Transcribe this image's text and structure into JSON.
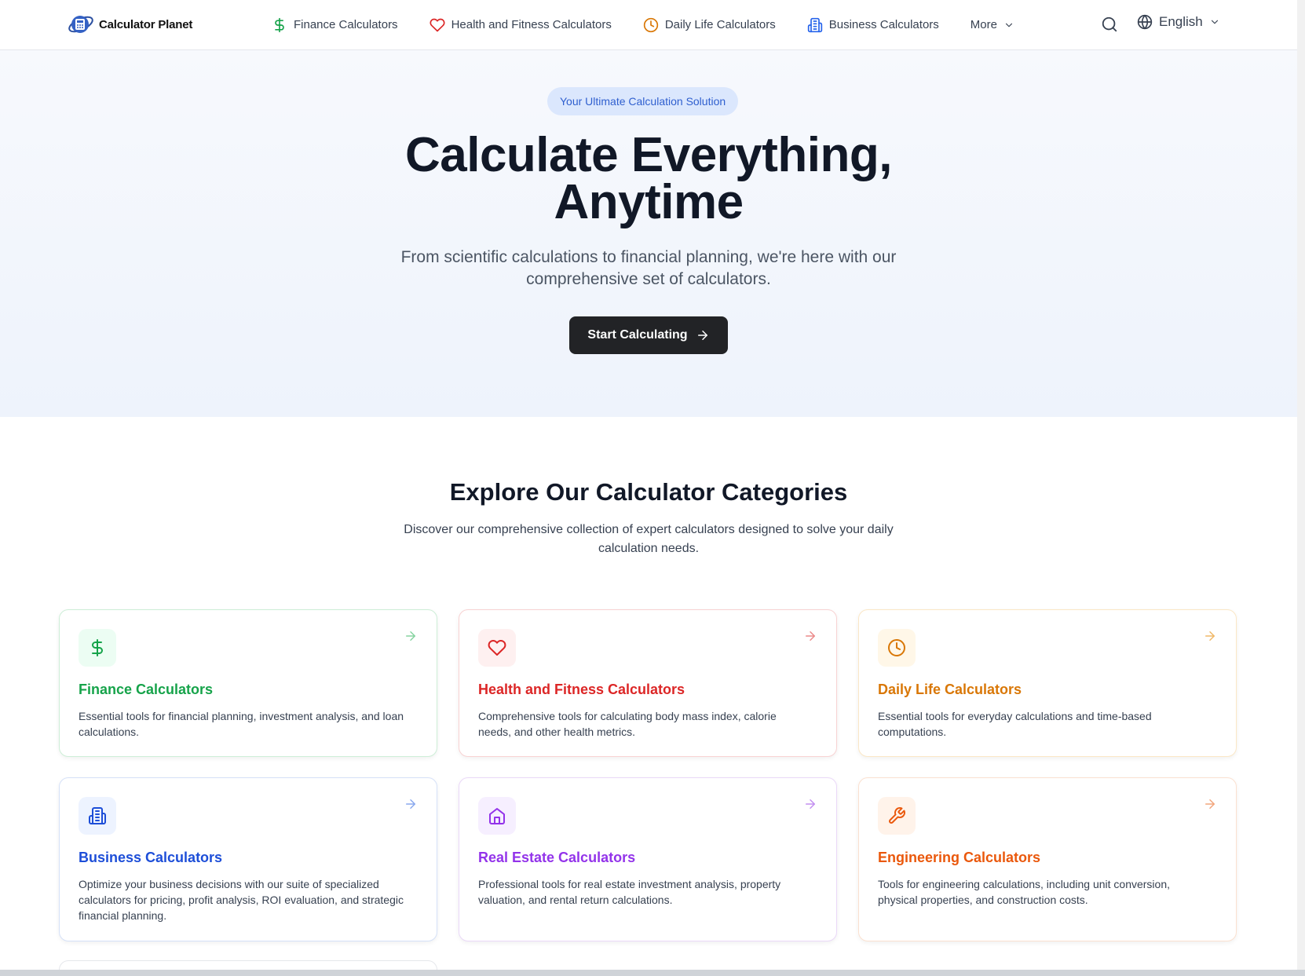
{
  "header": {
    "logo_text": "Calculator Planet",
    "nav": [
      {
        "label": "Finance Calculators",
        "icon": "dollar-icon",
        "color": "#16a34a"
      },
      {
        "label": "Health and Fitness Calculators",
        "icon": "heart-icon",
        "color": "#dc2626"
      },
      {
        "label": "Daily Life Calculators",
        "icon": "clock-icon",
        "color": "#d97706"
      },
      {
        "label": "Business Calculators",
        "icon": "building-icon",
        "color": "#2563eb"
      }
    ],
    "more_label": "More",
    "language": "English"
  },
  "hero": {
    "badge": "Your Ultimate Calculation Solution",
    "title_line1": "Calculate Everything,",
    "title_line2": "Anytime",
    "subtitle": "From scientific calculations to financial planning, we're here with our comprehensive set of calculators.",
    "cta_label": "Start Calculating"
  },
  "categories": {
    "title": "Explore Our Calculator Categories",
    "subtitle": "Discover our comprehensive collection of expert calculators designed to solve your daily calculation needs.",
    "cards": [
      {
        "title": "Finance Calculators",
        "description": "Essential tools for financial planning, investment analysis, and loan calculations.",
        "icon": "dollar-icon",
        "color": "#16a34a"
      },
      {
        "title": "Health and Fitness Calculators",
        "description": "Comprehensive tools for calculating body mass index, calorie needs, and other health metrics.",
        "icon": "heart-icon",
        "color": "#dc2626"
      },
      {
        "title": "Daily Life Calculators",
        "description": "Essential tools for everyday calculations and time-based computations.",
        "icon": "clock-icon",
        "color": "#d97706"
      },
      {
        "title": "Business Calculators",
        "description": "Optimize your business decisions with our suite of specialized calculators for pricing, profit analysis, ROI evaluation, and strategic financial planning.",
        "icon": "building-icon",
        "color": "#1d4ed8"
      },
      {
        "title": "Real Estate Calculators",
        "description": "Professional tools for real estate investment analysis, property valuation, and rental return calculations.",
        "icon": "home-icon",
        "color": "#9333ea"
      },
      {
        "title": "Engineering Calculators",
        "description": "Tools for engineering calculations, including unit conversion, physical properties, and construction costs.",
        "icon": "wrench-icon",
        "color": "#ea580c"
      }
    ]
  }
}
